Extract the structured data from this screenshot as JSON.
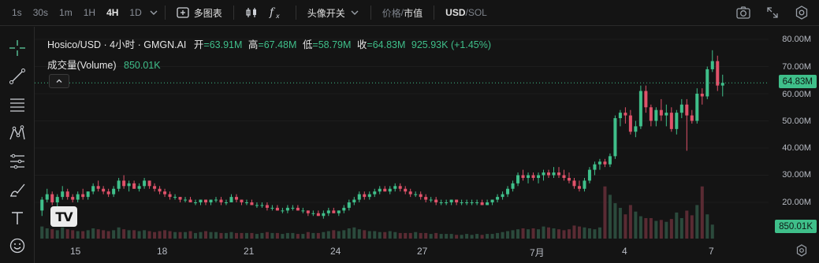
{
  "toolbar": {
    "intervals": [
      {
        "label": "1s",
        "active": false
      },
      {
        "label": "30s",
        "active": false
      },
      {
        "label": "1m",
        "active": false
      },
      {
        "label": "1H",
        "active": false
      },
      {
        "label": "4H",
        "active": true
      },
      {
        "label": "1D",
        "active": false
      }
    ],
    "multi_chart_label": "多图表",
    "indicator_label": "头像开关",
    "price_label": "价格",
    "marketcap_label": "市值",
    "usd_label": "USD",
    "sol_label": "SOL",
    "slash": "/"
  },
  "legend": {
    "title": "Hosico/USD · 4小时 · GMGN.AI",
    "open_label": "开",
    "open": "=63.91M",
    "high_label": "高",
    "high": "=67.48M",
    "low_label": "低",
    "low": "=58.79M",
    "close_label": "收",
    "close": "=64.83M",
    "change": "925.93K (+1.45%)",
    "volume_label": "成交量(Volume)",
    "volume": "850.01K"
  },
  "price_axis": [
    "80.00M",
    "70.00M",
    "60.00M",
    "50.00M",
    "40.00M",
    "30.00M",
    "20.00M"
  ],
  "current_price_tag": "64.83M",
  "current_volume_tag": "850.01K",
  "date_axis": [
    "15",
    "18",
    "21",
    "24",
    "27",
    "7月",
    "4",
    "7"
  ],
  "logo_text": "TV",
  "colors": {
    "up": "#3fbf8a",
    "down": "#e0526a",
    "background": "#141414"
  },
  "chart_data": {
    "type": "candlestick",
    "y_unit": "M",
    "ylim": [
      15,
      84
    ],
    "x_labels": [
      "15",
      "18",
      "21",
      "24",
      "27",
      "7月",
      "4",
      "7"
    ],
    "candles": [
      [
        17,
        22,
        15,
        21
      ],
      [
        21,
        25,
        20,
        23
      ],
      [
        23,
        24,
        19,
        20
      ],
      [
        20,
        23,
        18,
        22
      ],
      [
        22,
        26,
        21,
        24
      ],
      [
        24,
        25,
        21,
        22
      ],
      [
        22,
        23,
        20,
        21
      ],
      [
        21,
        24,
        20,
        23
      ],
      [
        23,
        25,
        21,
        22
      ],
      [
        22,
        24,
        21,
        24
      ],
      [
        24,
        27,
        23,
        26
      ],
      [
        26,
        28,
        24,
        25
      ],
      [
        25,
        26,
        23,
        24
      ],
      [
        24,
        25,
        22,
        23
      ],
      [
        23,
        26,
        22,
        25
      ],
      [
        25,
        29,
        24,
        28
      ],
      [
        28,
        30,
        25,
        26
      ],
      [
        26,
        28,
        24,
        27
      ],
      [
        27,
        28,
        25,
        25
      ],
      [
        25,
        27,
        24,
        26
      ],
      [
        26,
        29,
        25,
        28
      ],
      [
        28,
        28,
        25,
        26
      ],
      [
        26,
        27,
        24,
        25
      ],
      [
        25,
        26,
        23,
        24
      ],
      [
        24,
        25,
        22,
        23
      ],
      [
        23,
        24,
        21,
        22
      ],
      [
        22,
        23,
        21,
        22
      ],
      [
        22,
        22,
        20,
        21
      ],
      [
        21,
        22,
        20,
        21
      ],
      [
        21,
        22,
        20,
        20
      ],
      [
        20,
        21,
        19,
        20
      ],
      [
        20,
        21,
        19,
        21
      ],
      [
        21,
        21,
        19,
        20
      ],
      [
        20,
        21,
        19,
        21
      ],
      [
        21,
        22,
        20,
        21
      ],
      [
        21,
        22,
        19,
        20
      ],
      [
        20,
        21,
        19,
        20
      ],
      [
        20,
        23,
        20,
        22
      ],
      [
        22,
        23,
        20,
        21
      ],
      [
        21,
        21,
        19,
        20
      ],
      [
        20,
        21,
        19,
        20
      ],
      [
        20,
        21,
        19,
        19
      ],
      [
        19,
        20,
        18,
        19
      ],
      [
        19,
        20,
        18,
        19
      ],
      [
        19,
        20,
        17,
        18
      ],
      [
        18,
        19,
        17,
        18
      ],
      [
        18,
        19,
        17,
        17
      ],
      [
        17,
        18,
        16,
        17
      ],
      [
        17,
        19,
        16,
        18
      ],
      [
        18,
        19,
        17,
        18
      ],
      [
        18,
        19,
        17,
        17
      ],
      [
        17,
        18,
        16,
        17
      ],
      [
        17,
        17,
        15,
        16
      ],
      [
        16,
        17,
        15,
        16
      ],
      [
        16,
        17,
        15,
        15
      ],
      [
        15,
        17,
        14,
        16
      ],
      [
        16,
        18,
        15,
        17
      ],
      [
        17,
        18,
        16,
        16
      ],
      [
        16,
        17,
        15,
        17
      ],
      [
        17,
        19,
        16,
        18
      ],
      [
        18,
        21,
        17,
        20
      ],
      [
        20,
        22,
        19,
        21
      ],
      [
        21,
        24,
        20,
        23
      ],
      [
        23,
        24,
        21,
        22
      ],
      [
        22,
        24,
        21,
        23
      ],
      [
        23,
        25,
        22,
        24
      ],
      [
        24,
        26,
        23,
        25
      ],
      [
        25,
        26,
        24,
        24
      ],
      [
        24,
        26,
        23,
        25
      ],
      [
        25,
        27,
        24,
        26
      ],
      [
        26,
        27,
        24,
        25
      ],
      [
        25,
        26,
        23,
        24
      ],
      [
        24,
        25,
        22,
        23
      ],
      [
        23,
        24,
        22,
        23
      ],
      [
        23,
        24,
        21,
        22
      ],
      [
        22,
        23,
        20,
        21
      ],
      [
        21,
        22,
        20,
        21
      ],
      [
        21,
        22,
        19,
        20
      ],
      [
        20,
        21,
        19,
        20
      ],
      [
        20,
        21,
        19,
        20
      ],
      [
        20,
        21,
        19,
        21
      ],
      [
        21,
        21,
        19,
        20
      ],
      [
        20,
        21,
        19,
        20
      ],
      [
        20,
        21,
        19,
        20
      ],
      [
        20,
        21,
        19,
        20
      ],
      [
        20,
        21,
        19,
        20
      ],
      [
        20,
        21,
        19,
        19
      ],
      [
        19,
        21,
        19,
        20
      ],
      [
        20,
        21,
        19,
        21
      ],
      [
        21,
        23,
        20,
        22
      ],
      [
        22,
        24,
        21,
        23
      ],
      [
        23,
        26,
        22,
        25
      ],
      [
        25,
        28,
        24,
        27
      ],
      [
        27,
        31,
        26,
        30
      ],
      [
        30,
        32,
        28,
        29
      ],
      [
        29,
        31,
        27,
        30
      ],
      [
        30,
        31,
        28,
        29
      ],
      [
        29,
        31,
        27,
        30
      ],
      [
        30,
        32,
        28,
        31
      ],
      [
        31,
        32,
        29,
        30
      ],
      [
        30,
        33,
        29,
        31
      ],
      [
        31,
        33,
        29,
        30
      ],
      [
        30,
        32,
        28,
        29
      ],
      [
        29,
        31,
        27,
        28
      ],
      [
        28,
        29,
        25,
        26
      ],
      [
        26,
        28,
        24,
        25
      ],
      [
        25,
        29,
        24,
        28
      ],
      [
        28,
        33,
        27,
        32
      ],
      [
        32,
        35,
        30,
        34
      ],
      [
        34,
        36,
        32,
        35
      ],
      [
        35,
        36,
        33,
        34
      ],
      [
        34,
        38,
        33,
        37
      ],
      [
        37,
        52,
        36,
        51
      ],
      [
        51,
        54,
        48,
        53
      ],
      [
        53,
        55,
        49,
        52
      ],
      [
        52,
        54,
        45,
        46
      ],
      [
        46,
        50,
        44,
        48
      ],
      [
        48,
        63,
        47,
        61
      ],
      [
        61,
        63,
        53,
        55
      ],
      [
        55,
        56,
        48,
        50
      ],
      [
        50,
        55,
        48,
        54
      ],
      [
        54,
        58,
        50,
        52
      ],
      [
        52,
        56,
        48,
        53
      ],
      [
        53,
        55,
        46,
        47
      ],
      [
        47,
        54,
        45,
        53
      ],
      [
        53,
        58,
        51,
        56
      ],
      [
        56,
        58,
        39,
        52
      ],
      [
        52,
        54,
        49,
        50
      ],
      [
        50,
        62,
        49,
        60
      ],
      [
        60,
        62,
        56,
        59
      ],
      [
        59,
        70,
        58,
        69
      ],
      [
        69,
        76,
        68,
        72
      ],
      [
        72,
        74,
        61,
        63
      ],
      [
        63,
        67,
        59,
        64
      ]
    ],
    "volume": {
      "unit": "M",
      "ylim": [
        0,
        6
      ],
      "values": [
        1.3,
        1.1,
        1.0,
        0.9,
        1.2,
        1.0,
        0.9,
        0.8,
        0.8,
        0.9,
        1.1,
        1.0,
        0.9,
        0.8,
        0.9,
        1.2,
        1.0,
        0.9,
        0.9,
        0.8,
        0.9,
        0.8,
        0.7,
        0.8,
        0.9,
        0.8,
        0.7,
        0.7,
        0.7,
        0.8,
        0.6,
        0.7,
        0.8,
        0.7,
        0.7,
        0.6,
        0.6,
        0.7,
        0.6,
        0.6,
        0.6,
        0.6,
        0.5,
        0.6,
        0.7,
        0.6,
        0.6,
        0.5,
        0.6,
        0.6,
        0.5,
        0.5,
        0.7,
        0.6,
        0.6,
        0.7,
        0.8,
        0.9,
        0.8,
        0.9,
        1.1,
        1.2,
        1.0,
        0.9,
        0.8,
        0.8,
        0.7,
        0.7,
        0.8,
        0.7,
        0.6,
        0.6,
        0.6,
        0.7,
        0.6,
        0.6,
        0.5,
        0.6,
        0.5,
        0.5,
        0.5,
        0.4,
        0.4,
        0.5,
        0.4,
        0.5,
        0.4,
        0.5,
        0.5,
        0.6,
        0.7,
        0.8,
        0.9,
        1.0,
        1.1,
        1.0,
        1.1,
        1.0,
        1.3,
        1.2,
        1.1,
        1.0,
        0.9,
        1.0,
        1.4,
        1.3,
        1.2,
        1.1,
        1.0,
        1.2,
        5.6,
        4.7,
        3.8,
        3.3,
        2.6,
        3.6,
        2.9,
        2.4,
        2.2,
        2.2,
        1.9,
        2.0,
        1.8,
        2.1,
        2.8,
        2.2,
        3.0,
        2.5,
        3.6,
        5.6,
        2.6,
        1.5
      ]
    }
  }
}
